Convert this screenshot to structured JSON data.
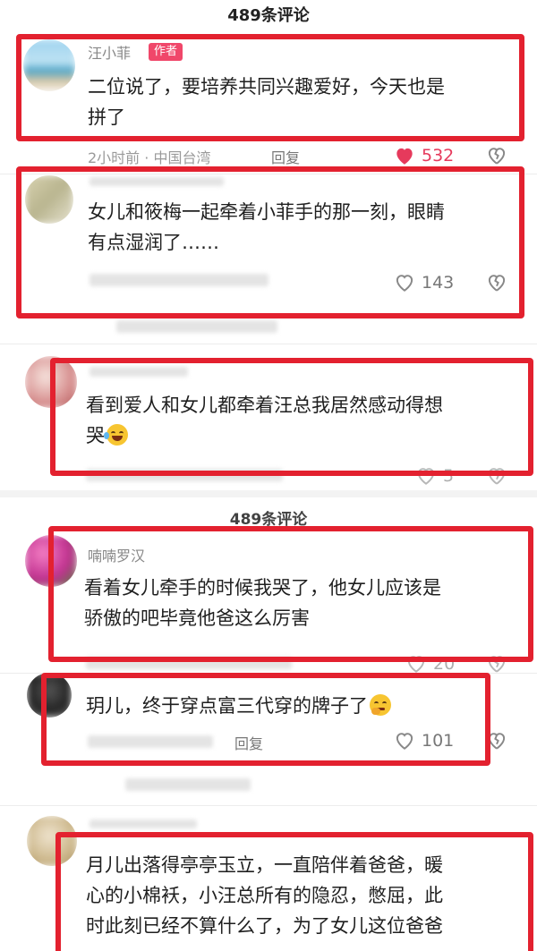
{
  "header": {
    "title": "489条评论"
  },
  "header_repeat": {
    "title": "489条评论"
  },
  "comments": [
    {
      "username": "汪小菲",
      "badge": "作者",
      "text_lines": [
        "二位说了，要培养共同兴趣爱好，今天也是",
        "拼了"
      ],
      "meta": "2小时前 · 中国台湾",
      "reply": "回复",
      "likes": "532",
      "liked": true
    },
    {
      "username": "",
      "text_lines": [
        "女儿和筱梅一起牵着小菲手的那一刻，眼睛",
        "有点湿润了……"
      ],
      "likes": "143"
    },
    {
      "username": "",
      "text_lines": [
        "看到爱人和女儿都牵着汪总我居然感动得想",
        "哭"
      ],
      "emoji": "laughing-crying-emoji",
      "likes": "5"
    },
    {
      "username": "喃喃罗汉",
      "text_lines": [
        "看着女儿牵手的时候我哭了，他女儿应该是",
        "骄傲的吧毕竟他爸这么厉害"
      ],
      "likes": "20"
    },
    {
      "username": "",
      "text_lines": [
        "玥儿，终于穿点富三代穿的牌子了"
      ],
      "emoji": "thinking-emoji",
      "reply": "回复",
      "likes": "101"
    },
    {
      "username": "",
      "text_lines": [
        "月儿出落得亭亭玉立，一直陪伴着爸爸，暖",
        "心的小棉袄，小汪总所有的隐忍，憋屈，此",
        "时此刻已经不算什么了，为了女儿这位爸爸"
      ]
    }
  ],
  "colors": {
    "highlight": "#e3212f",
    "like_active": "#e63a5c",
    "badge": "#f0476a"
  }
}
